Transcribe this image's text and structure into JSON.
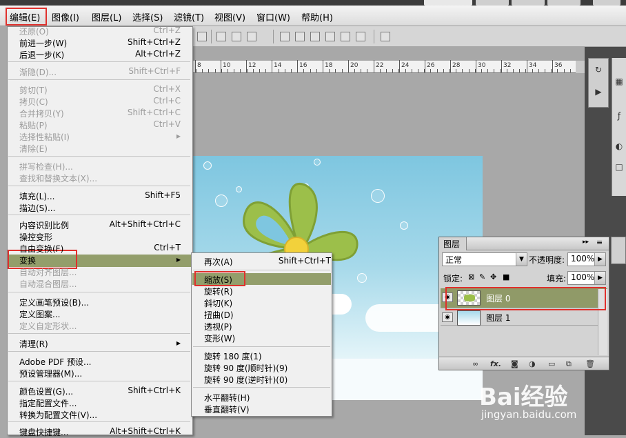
{
  "menubar": {
    "items": [
      "编辑(E)",
      "图像(I)",
      "图层(L)",
      "选择(S)",
      "滤镜(T)",
      "视图(V)",
      "窗口(W)",
      "帮助(H)"
    ]
  },
  "ruler": {
    "labels": [
      "8",
      "10",
      "12",
      "14",
      "16",
      "18",
      "20",
      "22",
      "24",
      "26",
      "28",
      "30",
      "32",
      "34",
      "36"
    ]
  },
  "edit_menu": {
    "items": [
      {
        "label": "还原(O)",
        "shortcut": "Ctrl+Z",
        "disabled": true
      },
      {
        "label": "前进一步(W)",
        "shortcut": "Shift+Ctrl+Z",
        "disabled": false
      },
      {
        "label": "后退一步(K)",
        "shortcut": "Alt+Ctrl+Z",
        "disabled": false
      },
      {
        "label": "渐隐(D)...",
        "shortcut": "Shift+Ctrl+F",
        "disabled": true
      },
      {
        "label": "剪切(T)",
        "shortcut": "Ctrl+X",
        "disabled": true
      },
      {
        "label": "拷贝(C)",
        "shortcut": "Ctrl+C",
        "disabled": true
      },
      {
        "label": "合并拷贝(Y)",
        "shortcut": "Shift+Ctrl+C",
        "disabled": true
      },
      {
        "label": "粘贴(P)",
        "shortcut": "Ctrl+V",
        "disabled": true
      },
      {
        "label": "选择性粘贴(I)",
        "shortcut": "",
        "disabled": true
      },
      {
        "label": "清除(E)",
        "shortcut": "",
        "disabled": true
      },
      {
        "label": "拼写检查(H)...",
        "shortcut": "",
        "disabled": true
      },
      {
        "label": "查找和替换文本(X)...",
        "shortcut": "",
        "disabled": true
      },
      {
        "label": "填充(L)...",
        "shortcut": "Shift+F5",
        "disabled": false
      },
      {
        "label": "描边(S)...",
        "shortcut": "",
        "disabled": false
      },
      {
        "label": "内容识别比例",
        "shortcut": "Alt+Shift+Ctrl+C",
        "disabled": false
      },
      {
        "label": "操控变形",
        "shortcut": "",
        "disabled": false
      },
      {
        "label": "自由变换(F)",
        "shortcut": "Ctrl+T",
        "disabled": false
      },
      {
        "label": "变换",
        "shortcut": "",
        "disabled": false
      },
      {
        "label": "自动对齐图层...",
        "shortcut": "",
        "disabled": true
      },
      {
        "label": "自动混合图层...",
        "shortcut": "",
        "disabled": true
      },
      {
        "label": "定义画笔预设(B)...",
        "shortcut": "",
        "disabled": false
      },
      {
        "label": "定义图案...",
        "shortcut": "",
        "disabled": false
      },
      {
        "label": "定义自定形状...",
        "shortcut": "",
        "disabled": true
      },
      {
        "label": "清理(R)",
        "shortcut": "",
        "disabled": false
      },
      {
        "label": "Adobe PDF 预设...",
        "shortcut": "",
        "disabled": false
      },
      {
        "label": "预设管理器(M)...",
        "shortcut": "",
        "disabled": false
      },
      {
        "label": "颜色设置(G)...",
        "shortcut": "Shift+Ctrl+K",
        "disabled": false
      },
      {
        "label": "指定配置文件...",
        "shortcut": "",
        "disabled": false
      },
      {
        "label": "转换为配置文件(V)...",
        "shortcut": "",
        "disabled": false
      },
      {
        "label": "键盘快捷键...",
        "shortcut": "Alt+Shift+Ctrl+K",
        "disabled": false
      }
    ]
  },
  "transform_submenu": {
    "items": [
      {
        "label": "再次(A)",
        "shortcut": "Shift+Ctrl+T"
      },
      {
        "label": "缩放(S)",
        "shortcut": ""
      },
      {
        "label": "旋转(R)",
        "shortcut": ""
      },
      {
        "label": "斜切(K)",
        "shortcut": ""
      },
      {
        "label": "扭曲(D)",
        "shortcut": ""
      },
      {
        "label": "透视(P)",
        "shortcut": ""
      },
      {
        "label": "变形(W)",
        "shortcut": ""
      },
      {
        "label": "旋转 180 度(1)",
        "shortcut": ""
      },
      {
        "label": "旋转 90 度(顺时针)(9)",
        "shortcut": ""
      },
      {
        "label": "旋转 90 度(逆时针)(0)",
        "shortcut": ""
      },
      {
        "label": "水平翻转(H)",
        "shortcut": ""
      },
      {
        "label": "垂直翻转(V)",
        "shortcut": ""
      }
    ]
  },
  "layers_panel": {
    "tab": "图层",
    "blend_mode": "正常",
    "opacity_label": "不透明度:",
    "opacity": "100%",
    "lock_label": "锁定:",
    "fill_label": "填充:",
    "fill": "100%",
    "layers": [
      {
        "name": "图层 0",
        "selected": true
      },
      {
        "name": "图层 1",
        "selected": false
      }
    ],
    "footer_fx": "fx."
  },
  "watermark": {
    "brand": "Bai经验",
    "url": "jingyan.baidu.com"
  },
  "colors": {
    "highlight": "#939e6b",
    "annotation_red": "#e0302c"
  }
}
